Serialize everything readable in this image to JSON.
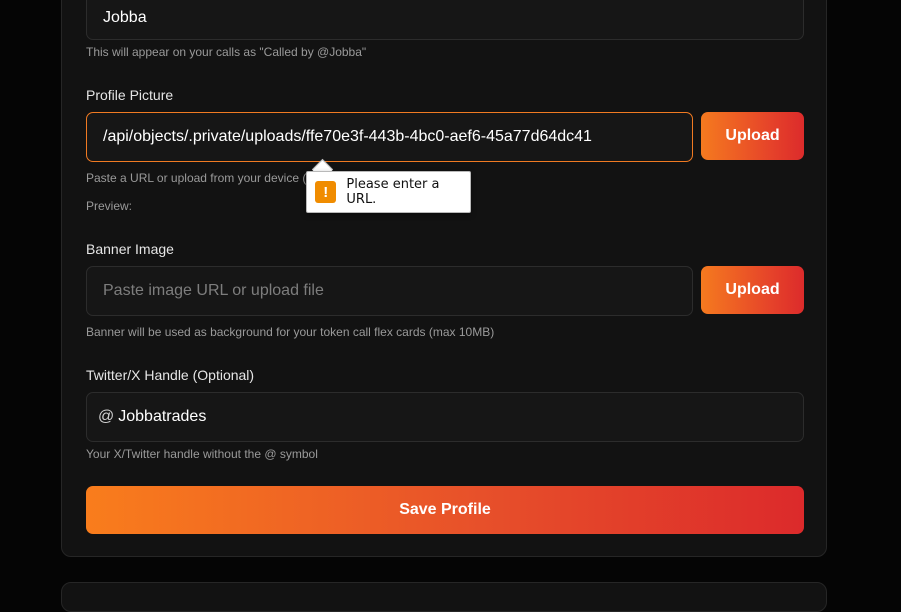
{
  "display_name": {
    "value": "Jobba",
    "help": "This will appear on your calls as \"Called by @Jobba\""
  },
  "profile_picture": {
    "label": "Profile Picture",
    "value": "/api/objects/.private/uploads/ffe70e3f-443b-4bc0-aef6-45a77d64dc41",
    "upload_label": "Upload",
    "help": "Paste a URL or upload from your device (",
    "preview_label": "Preview:",
    "validation_message": "Please enter a URL."
  },
  "banner_image": {
    "label": "Banner Image",
    "placeholder": "Paste image URL or upload file",
    "upload_label": "Upload",
    "help": "Banner will be used as background for your token call flex cards (max 10MB)"
  },
  "twitter": {
    "label": "Twitter/X Handle (Optional)",
    "prefix": "@",
    "value": "Jobbatrades",
    "help": "Your X/Twitter handle without the @ symbol"
  },
  "save_label": "Save Profile",
  "colors": {
    "accent_start": "#f97d1c",
    "accent_end": "#dc2a2b",
    "focus_border": "#f07a22",
    "warning": "#f08c00"
  },
  "icons": {
    "validation": "warning-icon"
  }
}
